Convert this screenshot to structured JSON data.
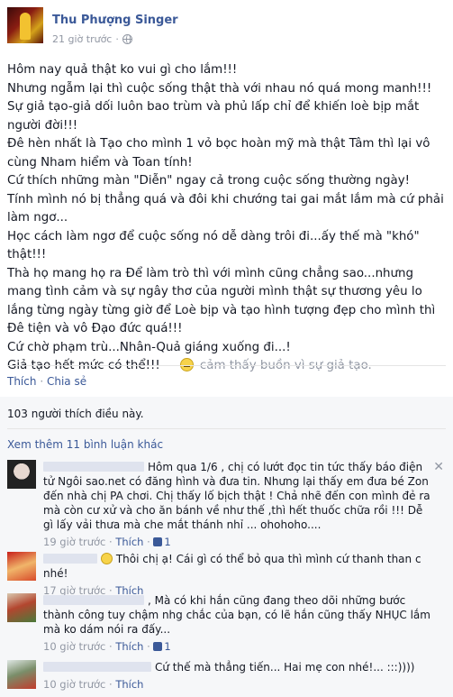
{
  "post": {
    "author": "Thu Phượng Singer",
    "time": "21 giờ trước",
    "lines": [
      "Hôm nay quả thật ko vui gì cho lắm!!!",
      "Nhưng ngẫm lại thì cuộc sống thật thà với nhau nó quá mong manh!!!",
      "Sự giả tạo-giả dối luôn bao trùm và phủ lấp chỉ để khiến loè bịp mắt người đời!!!",
      "Đê hèn nhất là Tạo cho mình 1 vỏ bọc hoàn mỹ mà thật Tâm thì lại vô cùng Nham hiểm và Toan tính!",
      "Cứ thích những màn \"Diễn\" ngay cả trong cuộc sống thường ngày!",
      "Tính mình nó bị thẳng quá và đôi khi chướng tai gai mắt lắm mà cứ phải làm ngơ...",
      "Học cách làm ngơ để cuộc sống nó dễ dàng trôi đi...ấy thế mà \"khó\" thật!!!",
      "Thà họ mang họ ra Để làm trò thì với mình cũng chẳng sao...nhưng mang tình cảm và sự ngây thơ của người mình thật sự thương yêu lo lắng từng ngày từng giờ để Loè bịp và tạo hình tượng đẹp cho mình thì Đê tiện và vô Đạo đức quá!!!",
      "Cứ chờ phạm trù...Nhân-Quả giáng xuống đi...!"
    ],
    "last_line": "Giả tạo hết mức có thể!!! —",
    "feeling": "cảm thấy buồn vì sự giả tạo."
  },
  "actions": {
    "like": "Thích",
    "share": "Chia sẻ",
    "sep": "·"
  },
  "likes_summary": "103 người thích điều này.",
  "more_comments": "Xem thêm 11 bình luận khác",
  "comments": [
    {
      "text": "Hôm qua 1/6 , chị có lướt đọc tin tức thấy báo điện tử Ngôi sao.net có đăng hình và đưa tin. Nhưng lại thấy em đưa bé Zon đến nhà chị PA chơi. Chị thấy lố bịch thật ! Chả nhẽ đến con mình đẻ ra mà còn cư xử và cho ăn bánh về như thế ,thì hết thuốc chữa rồi !!! Dễ gì lấy vải thưa mà che mắt thánh nhỉ ... ohohoho....",
      "time": "19 giờ trước",
      "like": "Thích",
      "count": "1"
    },
    {
      "text": "Thôi chị ạ! Cái gì có thể bỏ qua thì mình cứ thanh than c nhé!",
      "time": "17 giờ trước",
      "like": "Thích"
    },
    {
      "text": ", Mà có khi hắn cũng đang theo dõi những bước thành công tuy chậm nhg chắc của bạn, có lẽ hắn cũng thấy NHỤC lắm mà ko dám nói ra đấy...",
      "time": "10 giờ trước",
      "like": "Thích",
      "count": "1"
    },
    {
      "text": "Cứ thế mà thẳng tiến... Hai mẹ con nhé!... :::))))",
      "time": "10 giờ trước",
      "like": "Thích"
    }
  ],
  "icons": {
    "globe": "globe-icon",
    "feeling": "sad-face-icon",
    "like": "thumbs-up-icon",
    "close": "close-icon"
  },
  "colors": {
    "link": "#3b5998",
    "muted": "#9197a3",
    "feedback_bg": "#f6f7f9"
  }
}
